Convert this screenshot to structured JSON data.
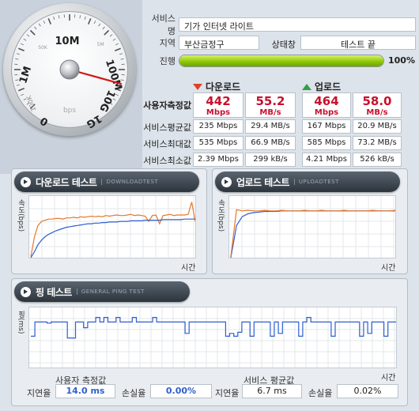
{
  "info": {
    "service_label": "서비스명",
    "service_value": "기가 인터넷 라이트",
    "region_label": "지역",
    "region_value": "부산금정구",
    "status_label": "상태창",
    "status_value": "테스트 끝",
    "progress_label": "진행",
    "progress_pct": 100,
    "progress_text": "100%"
  },
  "gauge": {
    "unit": "bps",
    "labels": [
      "10M",
      "1M",
      "100M",
      "100K",
      "1G",
      "0",
      "10G",
      "50K",
      "5M",
      "500K",
      "500M",
      "500K",
      "5G"
    ],
    "needle_value_label": "100M"
  },
  "stats": {
    "download_header": "다운로드",
    "upload_header": "업로드",
    "measured_label": "사용자측정값",
    "download_measured": {
      "mbps": "442",
      "mbps_unit": "Mbps",
      "mbs": "55.2",
      "mbs_unit": "MB/s"
    },
    "upload_measured": {
      "mbps": "464",
      "mbps_unit": "Mbps",
      "mbs": "58.0",
      "mbs_unit": "MB/s"
    },
    "rows": [
      {
        "label": "서비스평균값",
        "dl_a": "235 Mbps",
        "dl_b": "29.4 MB/s",
        "ul_a": "167 Mbps",
        "ul_b": "20.9 MB/s"
      },
      {
        "label": "서비스최대값",
        "dl_a": "535 Mbps",
        "dl_b": "66.9 MB/s",
        "ul_a": "585 Mbps",
        "ul_b": "73.2 MB/s"
      },
      {
        "label": "서비스최소값",
        "dl_a": "2.39 Mbps",
        "dl_b": "299 kB/s",
        "ul_a": "4.21 Mbps",
        "ul_b": "526 kB/s"
      }
    ]
  },
  "download_panel": {
    "title": "다운로드 테스트",
    "subtitle": "DOWNLOADTEST",
    "ylabel": "속도(bps)",
    "xlabel": "시간"
  },
  "upload_panel": {
    "title": "업로드 테스트",
    "subtitle": "UPLOADTEST",
    "ylabel": "속도(bps)",
    "xlabel": "시간"
  },
  "ping_panel": {
    "title": "핑 테스트",
    "subtitle": "GENERAL PING TEST",
    "ylabel": "핑(ms)",
    "xlabel": "시간",
    "user_caption": "사용자 측정값",
    "service_caption": "서비스 평균값",
    "latency_label": "지연율",
    "loss_label": "손실율",
    "user_latency": "14.0 ms",
    "user_loss": "0.00%",
    "service_latency": "6.7 ms",
    "service_loss": "0.02%"
  },
  "colors": {
    "measured_red": "#c8102e",
    "download_arrow": "#e0402c",
    "upload_arrow": "#2ea04a",
    "series_orange": "#e6782a",
    "series_blue": "#2f5fd0",
    "progress_green": "#8bc400"
  },
  "chart_data": [
    {
      "type": "line",
      "title": "다운로드 테스트",
      "xlabel": "시간",
      "ylabel": "속도(bps)",
      "series": [
        {
          "values": [
            0.02,
            0.35,
            0.55,
            0.62,
            0.64,
            0.66,
            0.66,
            0.67,
            0.67,
            0.66,
            0.68,
            0.68,
            0.69,
            0.68,
            0.7,
            0.69,
            0.7,
            0.71,
            0.7,
            0.71,
            0.7,
            0.72,
            0.71,
            0.72,
            0.73,
            0.72,
            0.72,
            0.73,
            0.74,
            0.72,
            0.73,
            0.72,
            0.71,
            0.62,
            0.72,
            0.73,
            0.58,
            0.72,
            0.73,
            0.74,
            0.72,
            0.73,
            0.73,
            0.73,
            0.74,
            0.95,
            0.62
          ]
        },
        {
          "values": [
            0.0,
            0.1,
            0.22,
            0.3,
            0.36,
            0.4,
            0.43,
            0.46,
            0.48,
            0.5,
            0.52,
            0.53,
            0.54,
            0.55,
            0.56,
            0.57,
            0.58,
            0.58,
            0.59,
            0.59,
            0.6,
            0.6,
            0.61,
            0.61,
            0.61,
            0.62,
            0.62,
            0.62,
            0.63,
            0.63,
            0.63,
            0.63,
            0.64,
            0.64,
            0.64,
            0.64,
            0.64,
            0.65,
            0.65,
            0.65,
            0.65,
            0.65,
            0.65,
            0.66,
            0.66,
            0.66,
            0.66
          ]
        }
      ]
    },
    {
      "type": "line",
      "title": "업로드 테스트",
      "xlabel": "시간",
      "ylabel": "속도(bps)",
      "series": [
        {
          "values": [
            0.02,
            0.82,
            0.8,
            0.81,
            0.8,
            0.8,
            0.81,
            0.8,
            0.8,
            0.81,
            0.8,
            0.8,
            0.8,
            0.81,
            0.8,
            0.8,
            0.81,
            0.8,
            0.8,
            0.8,
            0.81,
            0.8,
            0.8,
            0.8,
            0.8,
            0.81,
            0.8,
            0.8,
            0.8,
            0.81
          ]
        },
        {
          "values": [
            0.0,
            0.55,
            0.7,
            0.75,
            0.77,
            0.78,
            0.79,
            0.79,
            0.79,
            0.8,
            0.8,
            0.8,
            0.8,
            0.8,
            0.8,
            0.8,
            0.8,
            0.8,
            0.8,
            0.8,
            0.8,
            0.8,
            0.8,
            0.8,
            0.8,
            0.8,
            0.8,
            0.8,
            0.8,
            0.8
          ]
        }
      ]
    },
    {
      "type": "line",
      "title": "핑 테스트",
      "xlabel": "시간",
      "ylabel": "핑(ms)",
      "series": [
        {
          "values": [
            0.55,
            0.8,
            0.8,
            0.8,
            0.78,
            0.8,
            0.8,
            0.8,
            0.8,
            0.52,
            0.52,
            0.8,
            0.8,
            0.7,
            0.8,
            0.8,
            0.88,
            0.8,
            0.88,
            0.8,
            0.8,
            0.88,
            0.8,
            0.8,
            0.8,
            0.88,
            0.8,
            0.8,
            0.8,
            0.8,
            0.88,
            0.8,
            0.8,
            0.8,
            0.8,
            0.8,
            0.8,
            0.8,
            0.6,
            0.8,
            0.8,
            0.8,
            0.8,
            0.8,
            0.8,
            0.8,
            0.8,
            0.8,
            0.55,
            0.6,
            0.55,
            0.62,
            0.8,
            0.8,
            0.55,
            0.8,
            0.8,
            0.8,
            0.8,
            0.55,
            0.8,
            0.6,
            0.8,
            0.8,
            0.8,
            0.8,
            0.55,
            0.8,
            0.88,
            0.8,
            0.8,
            0.8,
            0.8,
            0.8,
            0.55,
            0.8,
            0.8,
            0.8,
            0.8,
            0.8,
            0.8,
            0.55,
            0.8,
            0.6,
            0.8,
            0.8,
            0.8,
            0.55,
            0.8,
            0.8,
            0.8
          ]
        }
      ]
    }
  ]
}
